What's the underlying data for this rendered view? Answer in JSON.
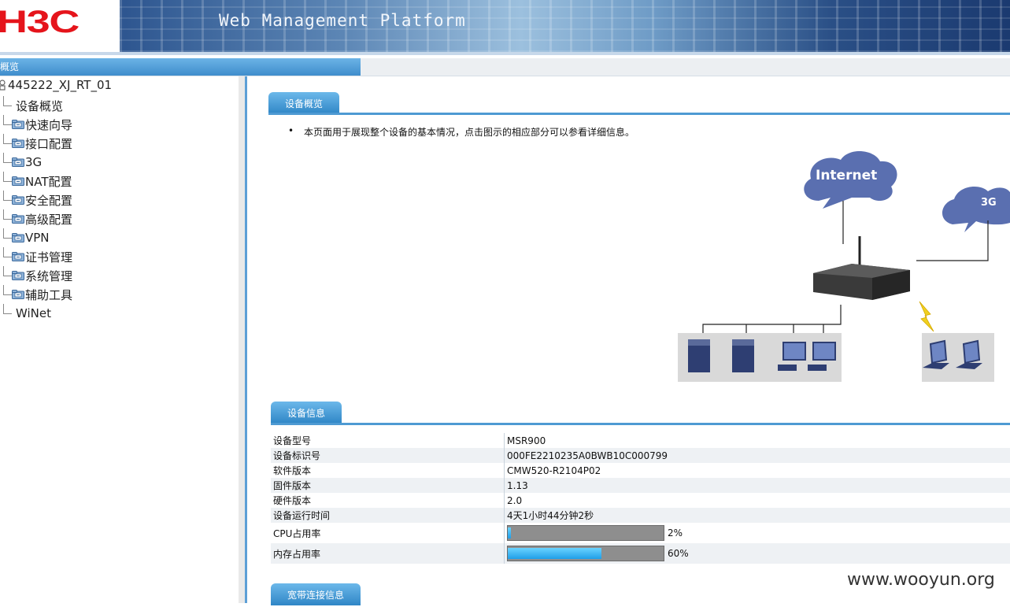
{
  "header": {
    "logo_text": "H3C",
    "platform_title": "Web Management Platform"
  },
  "navbar": {
    "tab_label": "概览"
  },
  "sidebar": {
    "root_label": "445222_XJ_RT_01",
    "items": [
      {
        "label": "设备概览",
        "icon": "none"
      },
      {
        "label": "快速向导",
        "icon": "folder-icon"
      },
      {
        "label": "接口配置",
        "icon": "folder-icon"
      },
      {
        "label": "3G",
        "icon": "folder-icon"
      },
      {
        "label": "NAT配置",
        "icon": "folder-icon"
      },
      {
        "label": "安全配置",
        "icon": "folder-icon"
      },
      {
        "label": "高级配置",
        "icon": "folder-icon"
      },
      {
        "label": "VPN",
        "icon": "folder-icon"
      },
      {
        "label": "证书管理",
        "icon": "folder-icon"
      },
      {
        "label": "系统管理",
        "icon": "folder-icon"
      },
      {
        "label": "辅助工具",
        "icon": "folder-icon"
      },
      {
        "label": "WiNet",
        "icon": "none"
      }
    ]
  },
  "overview": {
    "tab_label": "设备概览",
    "description": "本页面用于展现整个设备的基本情况，点击图示的相应部分可以参看详细信息。",
    "diagram": {
      "internet_label": "Internet",
      "g3_label": "3G"
    }
  },
  "device_info": {
    "tab_label": "设备信息",
    "rows": [
      {
        "label": "设备型号",
        "value": "MSR900"
      },
      {
        "label": "设备标识号",
        "value": "000FE2210235A0BWB10C000799"
      },
      {
        "label": "软件版本",
        "value": "CMW520-R2104P02"
      },
      {
        "label": "固件版本",
        "value": "1.13"
      },
      {
        "label": "硬件版本",
        "value": "2.0"
      },
      {
        "label": "设备运行时间",
        "value": "4天1小时44分钟2秒"
      }
    ],
    "cpu": {
      "label": "CPU占用率",
      "percent_text": "2%",
      "fraction": 0.02
    },
    "memory": {
      "label": "内存占用率",
      "percent_text": "60%",
      "fraction": 0.6
    }
  },
  "broadband": {
    "tab_label": "宽带连接信息"
  },
  "watermark": "www.wooyun.org",
  "colors": {
    "logo_red": "#e5141b",
    "header_blue": "#1d3f78",
    "tab_blue": "#3f8dcc",
    "cloud_blue": "#5a6fb0",
    "bar_fill": "#1f9ee8"
  }
}
